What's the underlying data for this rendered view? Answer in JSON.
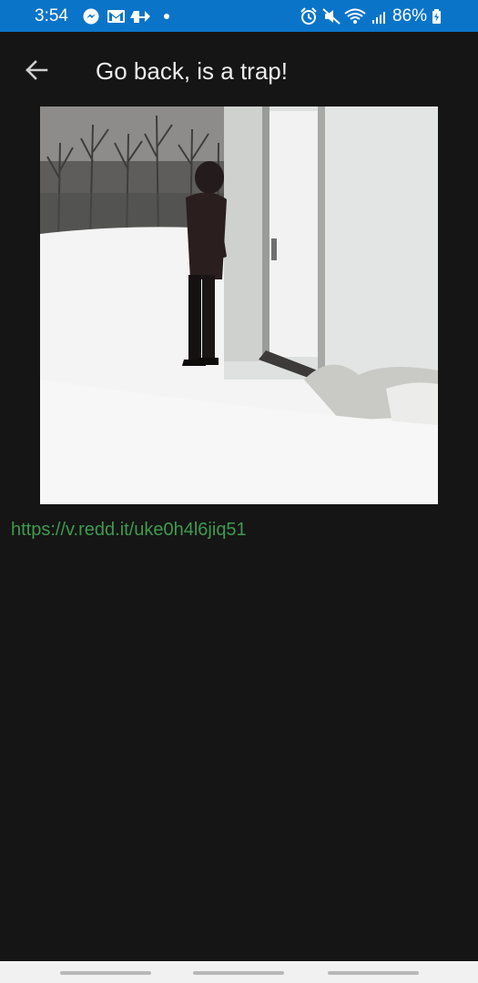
{
  "status_bar": {
    "time": "3:54",
    "battery": "86%",
    "background": "#0a74c9",
    "left_icons": [
      "messenger-icon",
      "gmail-icon",
      "app-icon",
      "dot-icon"
    ],
    "right_icons": [
      "alarm-icon",
      "mute-icon",
      "wifi-icon",
      "signal-icon",
      "battery-charging-icon"
    ]
  },
  "app_bar": {
    "title": "Go back, is a trap!",
    "back_icon": "back-arrow-icon"
  },
  "post": {
    "link": "https://v.redd.it/uke0h4l6jiq51",
    "link_color": "#3f9a4f",
    "media": "video-thumbnail"
  },
  "background": "#151515"
}
